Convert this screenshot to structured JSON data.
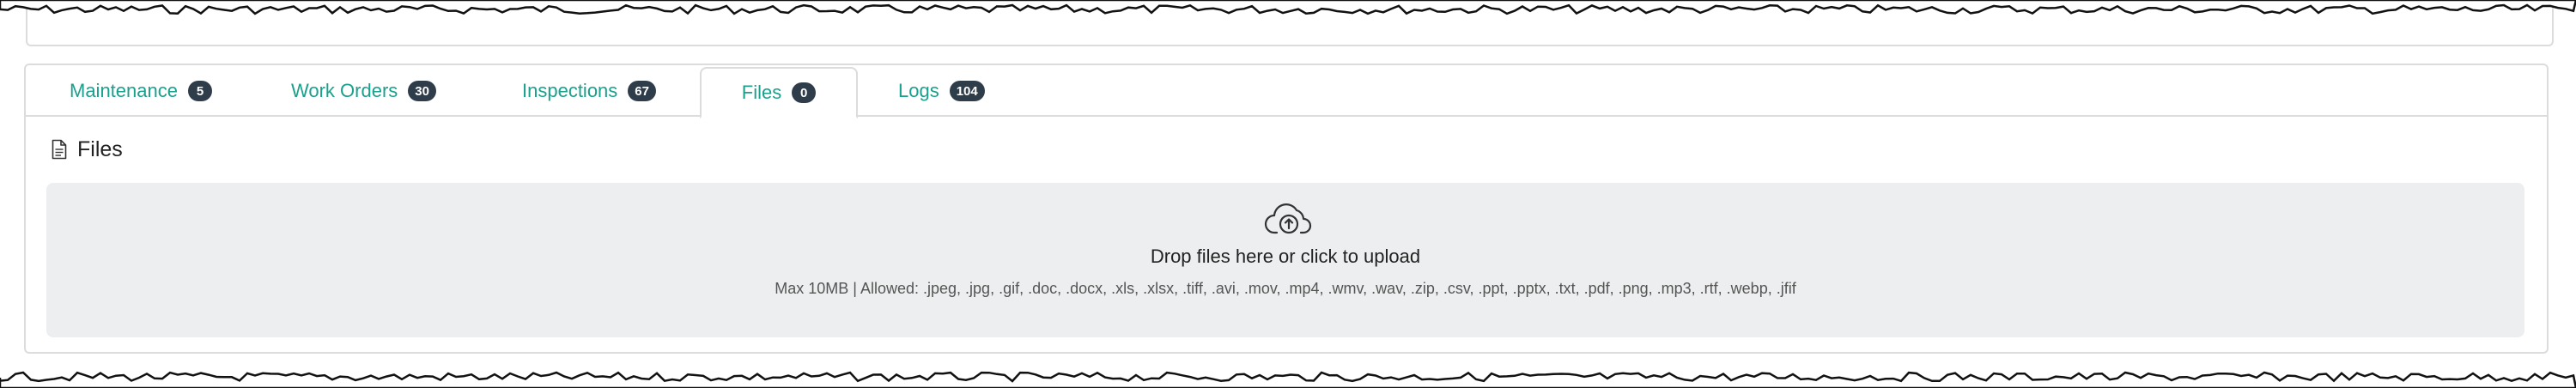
{
  "tabs": [
    {
      "label": "Maintenance",
      "count": "5"
    },
    {
      "label": "Work Orders",
      "count": "30"
    },
    {
      "label": "Inspections",
      "count": "67"
    },
    {
      "label": "Files",
      "count": "0",
      "active": true
    },
    {
      "label": "Logs",
      "count": "104"
    }
  ],
  "section": {
    "title": "Files",
    "icon": "file-icon"
  },
  "upload": {
    "icon": "cloud-upload-icon",
    "title": "Drop files here or click to upload",
    "subtitle": "Max 10MB | Allowed: .jpeg, .jpg, .gif, .doc, .docx, .xls, .xlsx, .tiff, .avi, .mov, .mp4, .wmv, .wav, .zip, .csv, .ppt, .pptx, .txt, .pdf, .png, .mp3, .rtf, .webp, .jfif"
  },
  "colors": {
    "accent": "#1aa08d",
    "badge": "#2f3d4b",
    "dropzone_bg": "#eceeef",
    "border": "#dcdcdc"
  }
}
